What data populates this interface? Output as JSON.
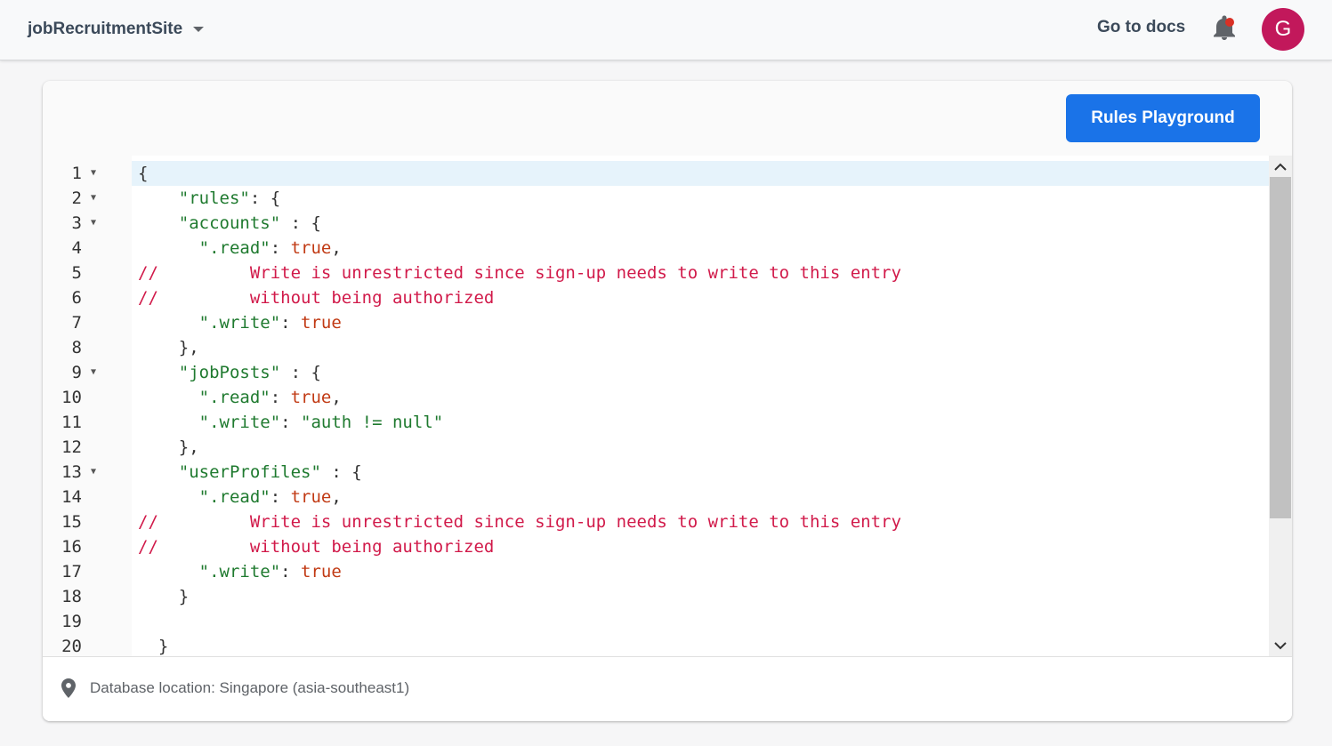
{
  "header": {
    "project_name": "jobRecruitmentSite",
    "docs_label": "Go to docs",
    "avatar_letter": "G"
  },
  "toolbar": {
    "rules_playground_label": "Rules Playground"
  },
  "editor": {
    "line_numbers": [
      "1",
      "2",
      "3",
      "4",
      "5",
      "6",
      "7",
      "8",
      "9",
      "10",
      "11",
      "12",
      "13",
      "14",
      "15",
      "16",
      "17",
      "18",
      "19",
      "20"
    ],
    "fold_lines": [
      1,
      2,
      3,
      9,
      13
    ],
    "code": {
      "l1": "{",
      "l2_key": "\"rules\"",
      "l2_rest": ": {",
      "l3_key": "\"accounts\"",
      "l3_rest": " : {",
      "l4_key": "\".read\"",
      "l4_colon": ": ",
      "l4_val": "true",
      "l4_end": ",",
      "l5": "//         Write is unrestricted since sign-up needs to write to this entry",
      "l6": "//         without being authorized",
      "l7_key": "\".write\"",
      "l7_colon": ": ",
      "l7_val": "true",
      "l8": "},",
      "l9_key": "\"jobPosts\"",
      "l9_rest": " : {",
      "l10_key": "\".read\"",
      "l10_colon": ": ",
      "l10_val": "true",
      "l10_end": ",",
      "l11_key": "\".write\"",
      "l11_colon": ": ",
      "l11_val": "\"auth != null\"",
      "l12": "},",
      "l13_key": "\"userProfiles\"",
      "l13_rest": " : {",
      "l14_key": "\".read\"",
      "l14_colon": ": ",
      "l14_val": "true",
      "l14_end": ",",
      "l15": "//         Write is unrestricted since sign-up needs to write to this entry",
      "l16": "//         without being authorized",
      "l17_key": "\".write\"",
      "l17_colon": ": ",
      "l17_val": "true",
      "l18": "}",
      "l19": "",
      "l20": "}"
    }
  },
  "footer": {
    "location_text": "Database location: Singapore (asia-southeast1)"
  },
  "colors": {
    "accent": "#1a73e8",
    "avatar": "#c2185b",
    "string": "#1f7a2f",
    "boolean": "#c13a14",
    "comment": "#d11a4a",
    "notification_dot": "#d93025"
  }
}
